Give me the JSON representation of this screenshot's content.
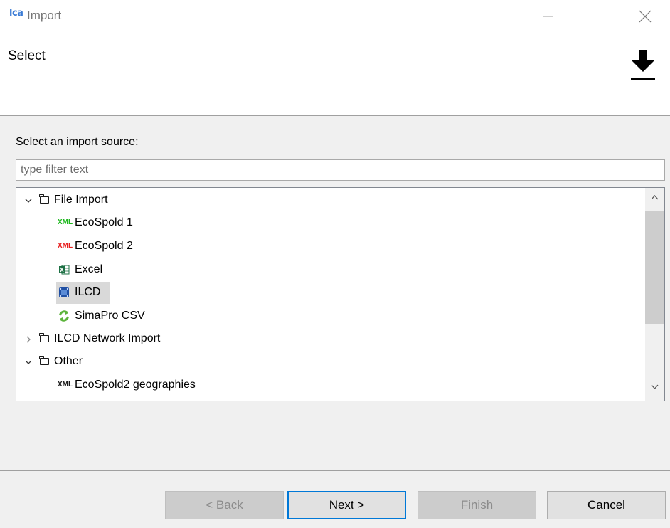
{
  "window": {
    "logo_text": "lca",
    "title": "Import"
  },
  "header": {
    "title": "Select",
    "icon": "download-icon"
  },
  "main": {
    "source_label": "Select an import source:",
    "filter_placeholder": "type filter text",
    "filter_value": ""
  },
  "tree": {
    "groups": [
      {
        "label": "File Import",
        "expanded": true,
        "items": [
          {
            "label": "EcoSpold 1",
            "icon": "xml-icon",
            "badge": "XML",
            "color": "#1db81d"
          },
          {
            "label": "EcoSpold 2",
            "icon": "xml-icon",
            "badge": "XML",
            "color": "#e81e1e"
          },
          {
            "label": "Excel",
            "icon": "excel-icon",
            "color": "#1d7044"
          },
          {
            "label": "ILCD",
            "icon": "ilcd-icon",
            "color": "#1f4fa3",
            "selected": true
          },
          {
            "label": "SimaPro CSV",
            "icon": "simapro-icon",
            "color": "#5cb43c"
          }
        ]
      },
      {
        "label": "ILCD Network Import",
        "expanded": false,
        "items": []
      },
      {
        "label": "Other",
        "expanded": true,
        "items": [
          {
            "label": "EcoSpold2 geographies",
            "icon": "xml-icon",
            "badge": "XML",
            "color": "#1a1a1a"
          }
        ]
      }
    ]
  },
  "footer": {
    "back_label": "< Back",
    "next_label": "Next >",
    "finish_label": "Finish",
    "cancel_label": "Cancel"
  },
  "colors": {
    "focus_border": "#0078d7",
    "selection": "#d9d9d9"
  }
}
